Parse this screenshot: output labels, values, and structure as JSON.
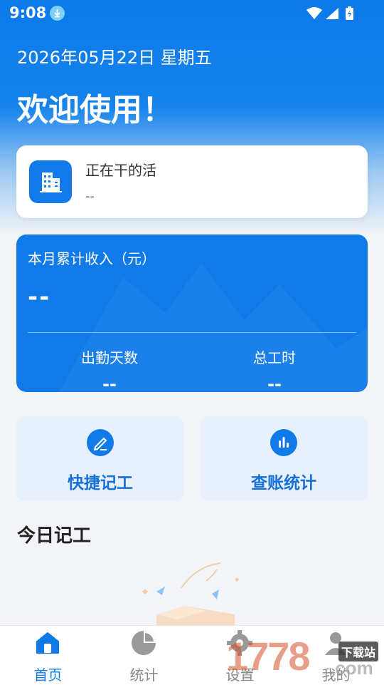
{
  "status_bar": {
    "time": "9:08"
  },
  "header": {
    "date": "2026年05月22日 星期五",
    "welcome": "欢迎使用！"
  },
  "job_card": {
    "title": "正在干的活",
    "value": "--"
  },
  "income_card": {
    "title": "本月累计收入（元）",
    "value": "--",
    "stats": [
      {
        "label": "出勤天数",
        "value": "--"
      },
      {
        "label": "总工时",
        "value": "--"
      }
    ]
  },
  "actions": [
    {
      "label": "快捷记工",
      "icon": "pen-icon"
    },
    {
      "label": "查账统计",
      "icon": "bar-chart-icon"
    }
  ],
  "today_section": {
    "title": "今日记工"
  },
  "tabbar": {
    "tabs": [
      {
        "label": "首页",
        "icon": "home-icon",
        "active": true
      },
      {
        "label": "统计",
        "icon": "pie-chart-icon",
        "active": false
      },
      {
        "label": "设置",
        "icon": "gear-icon",
        "active": false
      },
      {
        "label": "我的",
        "icon": "user-icon",
        "active": false
      }
    ]
  },
  "watermark": {
    "text": "1778",
    "suffix": ".com",
    "tag": "下载站"
  },
  "colors": {
    "primary": "#0f7ae8",
    "action_bg": "#e8f0fd",
    "page_bg": "#f2f4f7"
  }
}
